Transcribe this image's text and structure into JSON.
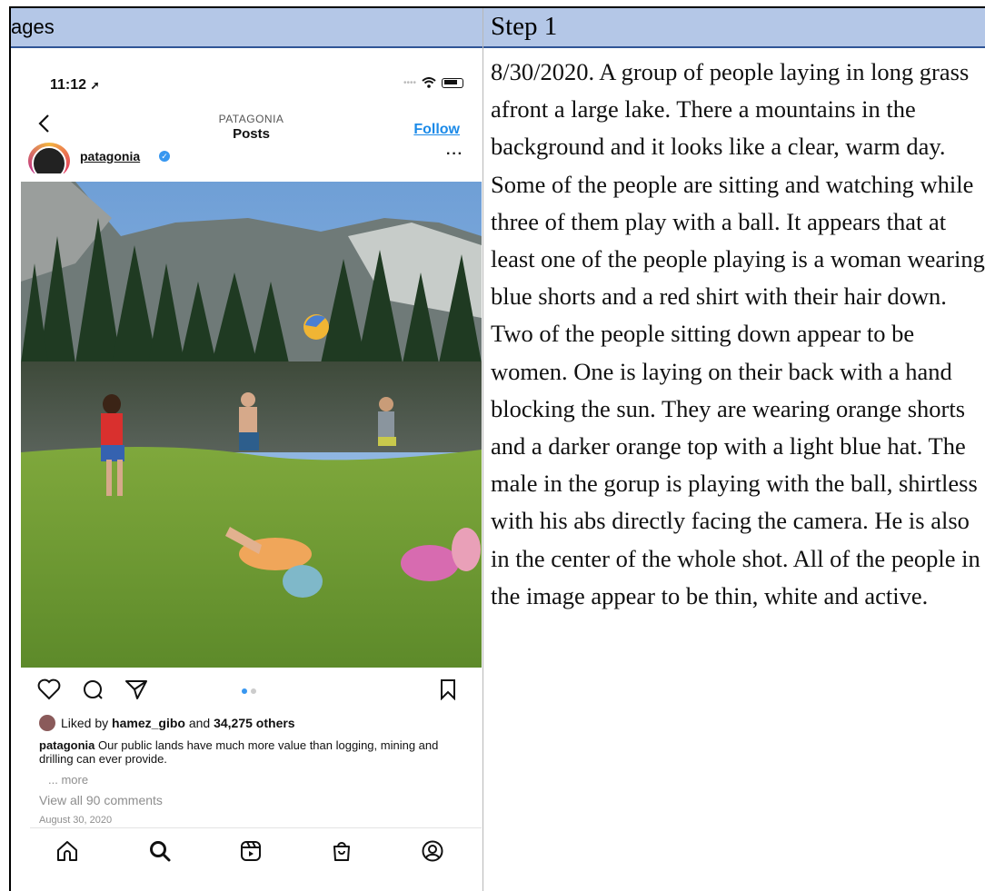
{
  "table": {
    "header_left": "ages",
    "header_right": "Step 1"
  },
  "story": {
    "text": "8/30/2020.  A group of people laying in long grass afront a large lake. There a mountains in the background and it looks like a clear, warm day. Some of the people are sitting and watching while three of them play with a ball. It appears that at least one of the people playing is a woman wearing blue shorts and a red shirt with their hair down. Two of the people sitting down appear to be women. One is laying on their back with a hand blocking the sun. They are wearing orange shorts and a darker orange top with a light blue hat. The male in the gorup is playing with the ball, shirtless with his abs directly facing the camera. He is also in the center of the whole shot. All of the people in the image appear to be thin, white and active."
  },
  "phone": {
    "status_time": "11:12",
    "nav_subtitle": "PATAGONIA",
    "nav_title": "Posts",
    "follow_label": "Follow",
    "account_name": "patagonia",
    "liked_prefix": "Liked by ",
    "liked_user": "hamez_gibo",
    "liked_mid": " and ",
    "liked_count": "34,275 others",
    "caption_user": "patagonia",
    "caption_text": " Our public lands have much more value than logging, mining and drilling can ever provide.",
    "more_label": "... more",
    "comments_label": "View all 90 comments",
    "post_date": "August 30, 2020",
    "icons": {
      "back": "chevron-left-icon",
      "like": "heart-icon",
      "comment": "comment-icon",
      "share": "send-icon",
      "save": "bookmark-icon",
      "home": "home-icon",
      "search": "search-icon",
      "reels": "reels-icon",
      "shop": "shop-icon",
      "profile": "profile-icon"
    },
    "colors": {
      "link_blue": "#1b8ae8",
      "verified_blue": "#3797f0",
      "header_bg": "#b4c7e7"
    }
  }
}
